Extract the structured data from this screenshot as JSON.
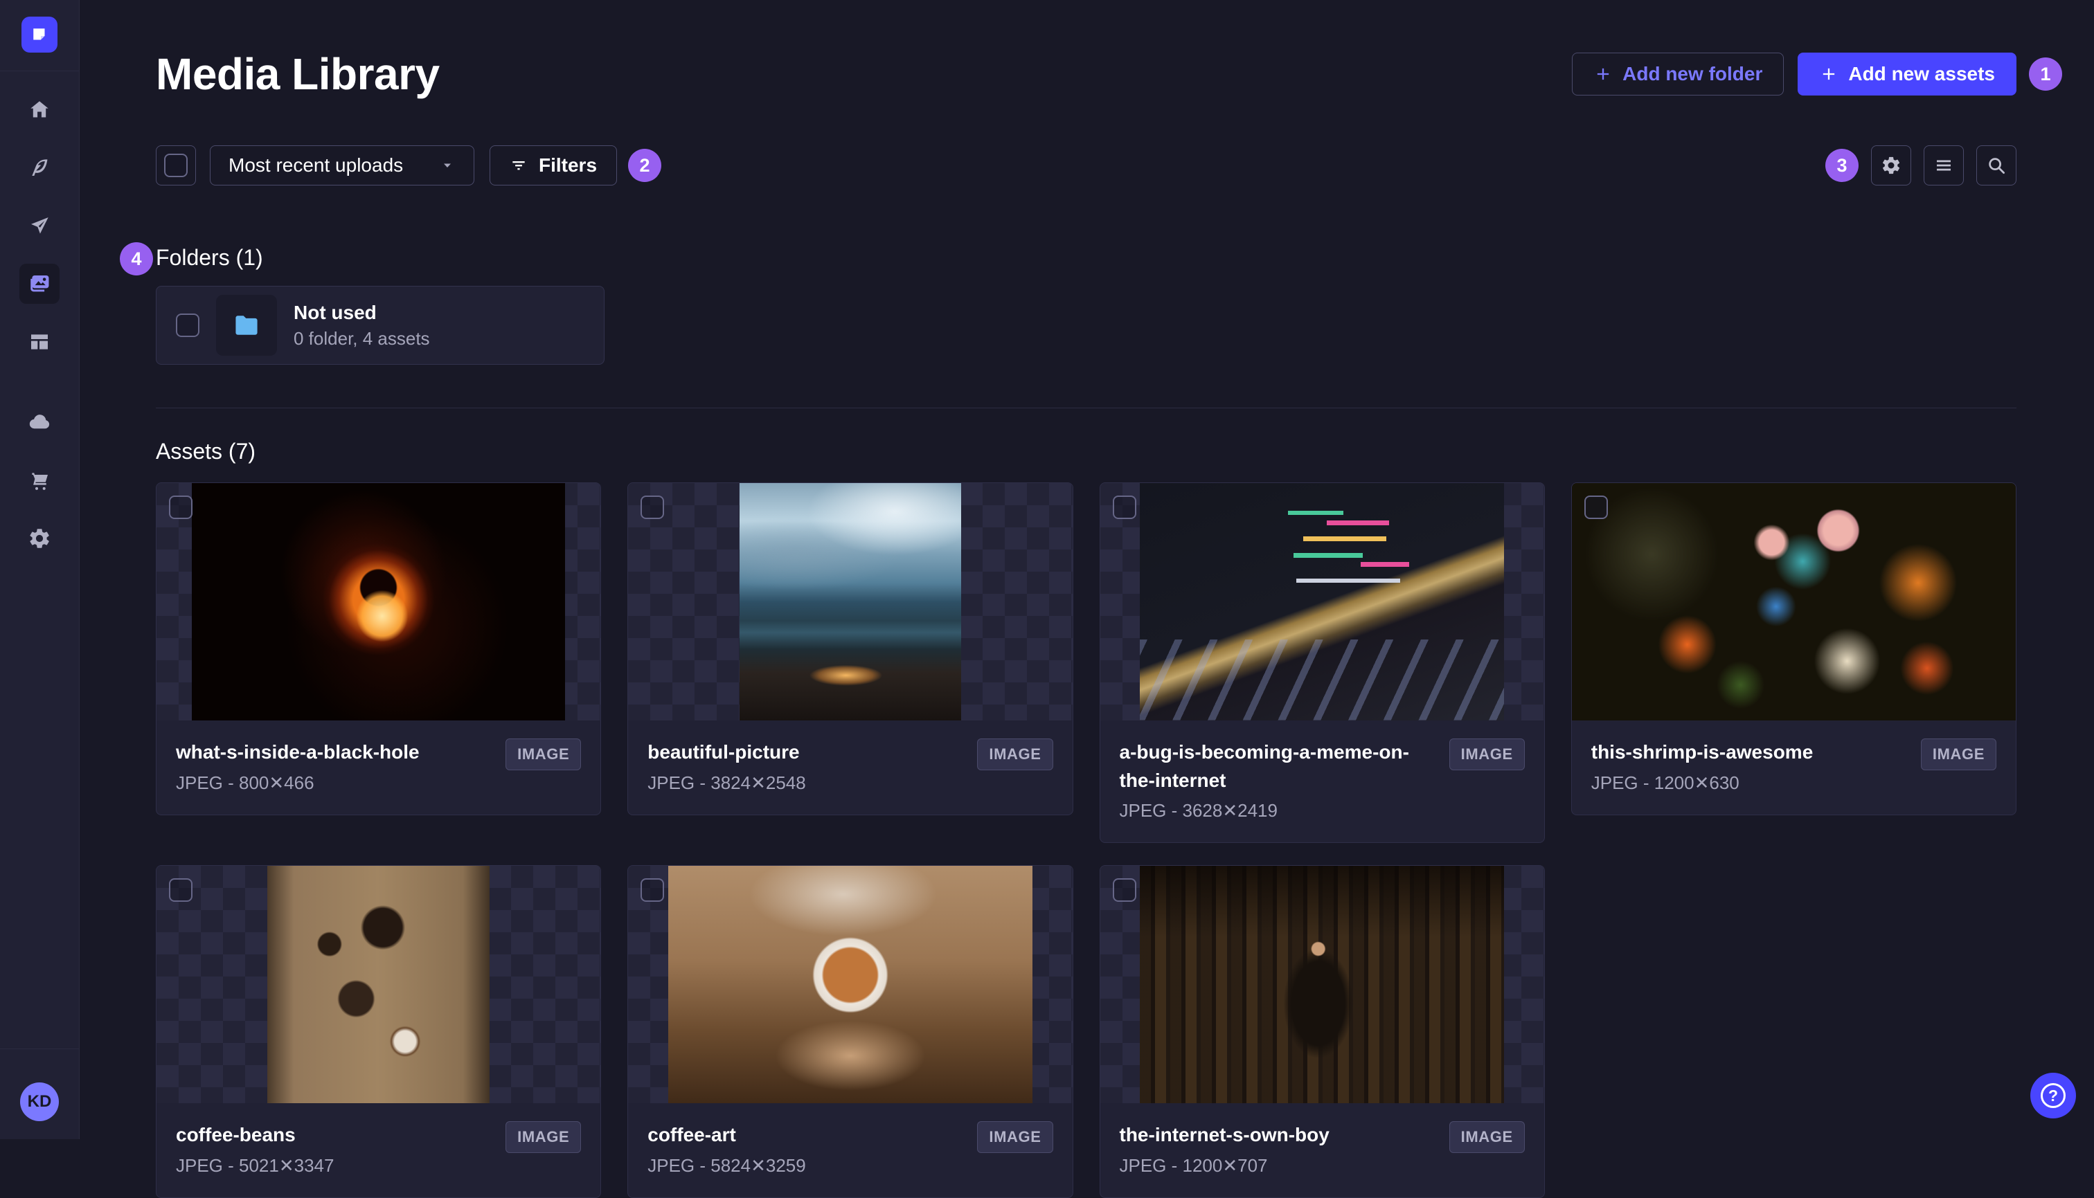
{
  "sidebar": {
    "logo_icon": "strapi-logo",
    "nav": [
      {
        "id": "home",
        "icon": "home-icon",
        "active": false
      },
      {
        "id": "content-manager",
        "icon": "feather-icon",
        "active": false
      },
      {
        "id": "releases",
        "icon": "paper-plane-icon",
        "active": false
      },
      {
        "id": "media-library",
        "icon": "images-icon",
        "active": true
      },
      {
        "id": "content-type-builder",
        "icon": "layout-icon",
        "active": false
      },
      {
        "id": "deploy",
        "icon": "cloud-icon",
        "active": false
      },
      {
        "id": "marketplace",
        "icon": "cart-icon",
        "active": false
      },
      {
        "id": "settings",
        "icon": "gear-icon",
        "active": false
      }
    ],
    "avatar_initials": "KD"
  },
  "header": {
    "title": "Media Library",
    "add_folder_label": "Add new folder",
    "add_assets_label": "Add new assets"
  },
  "toolbar": {
    "sort_value": "Most recent uploads",
    "filters_label": "Filters",
    "icons_right": [
      "gear-icon",
      "list-icon",
      "search-icon"
    ]
  },
  "annotations": {
    "n1": "1",
    "n2": "2",
    "n3": "3",
    "n4": "4"
  },
  "folders_section": {
    "title": "Folders (1)",
    "folders": [
      {
        "name": "Not used",
        "meta": "0 folder, 4 assets"
      }
    ]
  },
  "assets_section": {
    "title": "Assets (7)",
    "assets": [
      {
        "name": "what-s-inside-a-black-hole",
        "meta": "JPEG - 800✕466",
        "badge": "IMAGE",
        "thumb": "black-hole"
      },
      {
        "name": "beautiful-picture",
        "meta": "JPEG - 3824✕2548",
        "badge": "IMAGE",
        "thumb": "mountains"
      },
      {
        "name": "a-bug-is-becoming-a-meme-on-the-internet",
        "meta": "JPEG - 3628✕2419",
        "badge": "IMAGE",
        "thumb": "code"
      },
      {
        "name": "this-shrimp-is-awesome",
        "meta": "JPEG - 1200✕630",
        "badge": "IMAGE",
        "thumb": "shrimp"
      },
      {
        "name": "coffee-beans",
        "meta": "JPEG - 5021✕3347",
        "badge": "IMAGE",
        "thumb": "coffee-beans"
      },
      {
        "name": "coffee-art",
        "meta": "JPEG - 5824✕3259",
        "badge": "IMAGE",
        "thumb": "coffee-art"
      },
      {
        "name": "the-internet-s-own-boy",
        "meta": "JPEG - 1200✕707",
        "badge": "IMAGE",
        "thumb": "library"
      }
    ]
  },
  "help": {
    "glyph": "?"
  },
  "colors": {
    "background": "#181826",
    "surface": "#212134",
    "border": "#32324d",
    "primary": "#4945ff",
    "primary_light": "#7b79ff",
    "annotation_badge": "#9760f0",
    "text_muted": "#a5a5ba",
    "folder_icon_blue": "#66b7f1"
  }
}
